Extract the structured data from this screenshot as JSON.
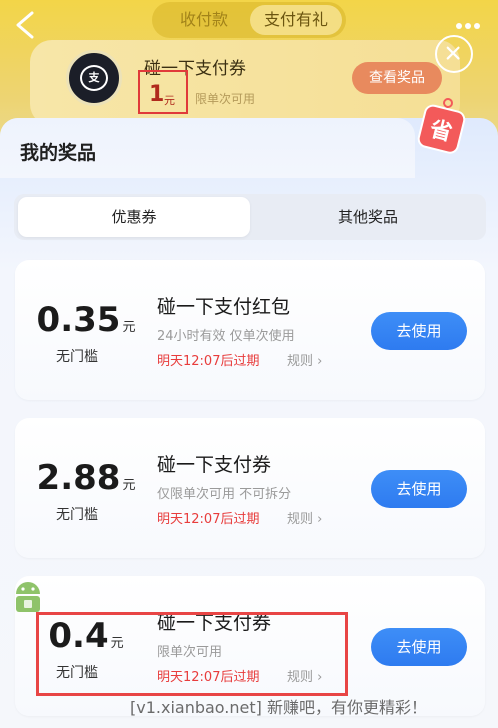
{
  "header": {
    "seg_tabs": [
      "收付款",
      "支付有礼"
    ],
    "card": {
      "title": "碰一下支付券",
      "amount": "1",
      "amount_unit": "元",
      "subtitle": "限单次可用",
      "button": "查看奖品"
    },
    "logo_text": "支"
  },
  "sheet": {
    "title": "我的奖品",
    "badge_text": "省",
    "tabs": [
      "优惠券",
      "其他奖品"
    ]
  },
  "coupons": [
    {
      "amount": "0.35",
      "unit": "元",
      "threshold": "无门槛",
      "title": "碰一下支付红包",
      "desc": "24小时有效 仅单次使用",
      "expiry": "明天12:07后过期",
      "rule": "规则 ›",
      "button": "去使用"
    },
    {
      "amount": "2.88",
      "unit": "元",
      "threshold": "无门槛",
      "title": "碰一下支付券",
      "desc": "仅限单次可用 不可拆分",
      "expiry": "明天12:07后过期",
      "rule": "规则 ›",
      "button": "去使用"
    },
    {
      "amount": "0.4",
      "unit": "元",
      "threshold": "无门槛",
      "title": "碰一下支付券",
      "desc": "限单次可用",
      "expiry": "明天12:07后过期",
      "rule": "规则 ›",
      "button": "去使用"
    }
  ],
  "watermark": "[v1.xianbao.net] 新赚吧，有你更精彩！",
  "colors": {
    "primary_button": "#2e7bf0",
    "expiry_red": "#e83c3c",
    "header_yellow": "#f3d548",
    "highlight_box": "#e84545"
  }
}
